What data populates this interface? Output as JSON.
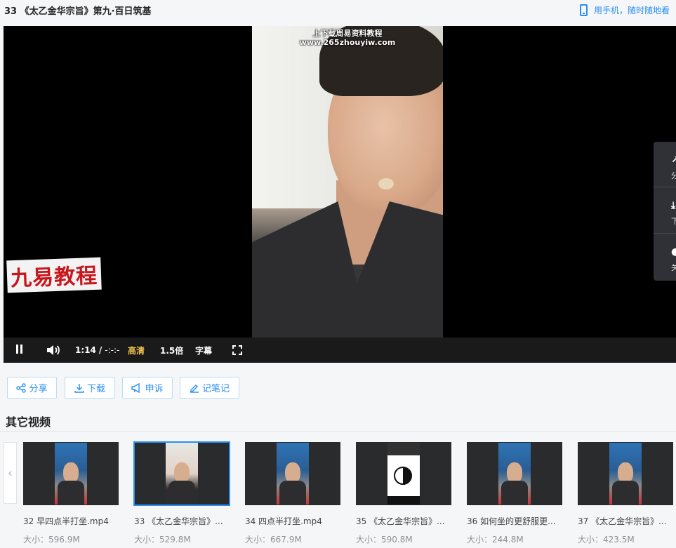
{
  "header": {
    "title": "33 《太乙金华宗旨》第九·百日筑基",
    "mobile_text": "用手机，随时随地看"
  },
  "player": {
    "watermark_line1": "上下载周易资料教程",
    "watermark_line2": "www.265zhouyiw.com",
    "logo_text": "九易教程",
    "current_time": "1:14",
    "time_separator": "/",
    "duration": "-:-:-",
    "quality": "高清",
    "speed": "1.5倍",
    "subtitle": "字幕",
    "side_panel": [
      {
        "icon": "share-icon",
        "label": "分"
      },
      {
        "icon": "download-icon",
        "label": "下"
      },
      {
        "icon": "light-icon",
        "label": "关"
      }
    ]
  },
  "actions": {
    "share": "分享",
    "download": "下载",
    "report": "申诉",
    "note": "记笔记"
  },
  "section_title": "其它视频",
  "videos": [
    {
      "name": "32 早四点半打坐.mp4",
      "size": "大小：596.9M",
      "thumb": "blue"
    },
    {
      "name": "33 《太乙金华宗旨》...",
      "size": "大小：529.8M",
      "thumb": "wall",
      "active": true
    },
    {
      "name": "34 四点半打坐.mp4",
      "size": "大小：667.9M",
      "thumb": "blue"
    },
    {
      "name": "35 《太乙金华宗旨》...",
      "size": "大小：590.8M",
      "thumb": "bagua"
    },
    {
      "name": "36 如何坐的更舒服更...",
      "size": "大小：244.8M",
      "thumb": "blue"
    },
    {
      "name": "37 《太乙金华宗旨》...",
      "size": "大小：423.5M",
      "thumb": "blue"
    }
  ],
  "colors": {
    "accent": "#2b8ff2",
    "quality_gold": "#f1c24d",
    "logo_red": "#c8161d"
  }
}
